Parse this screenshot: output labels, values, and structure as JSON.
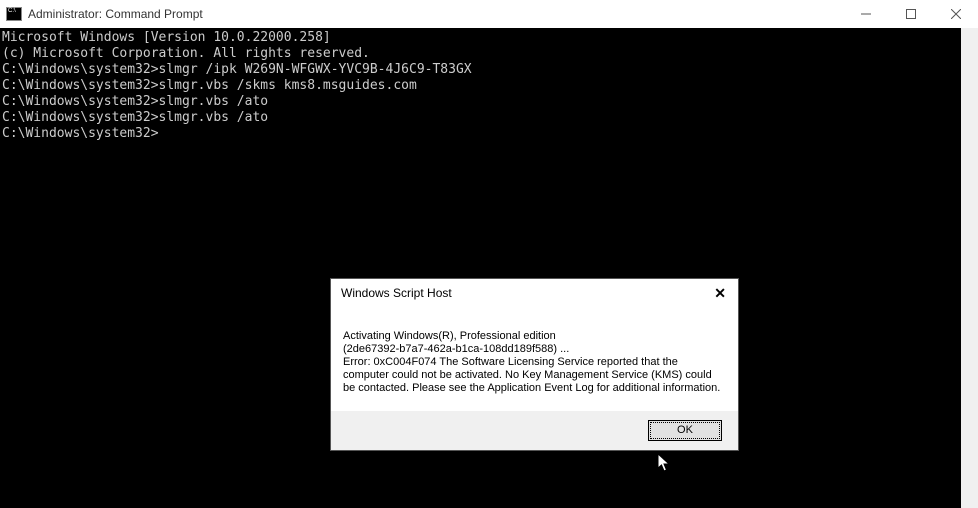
{
  "window": {
    "title": "Administrator: Command Prompt"
  },
  "terminal": {
    "line1": "Microsoft Windows [Version 10.0.22000.258]",
    "line2": "(c) Microsoft Corporation. All rights reserved.",
    "blank1": "",
    "line3": "C:\\Windows\\system32>slmgr /ipk W269N-WFGWX-YVC9B-4J6C9-T83GX",
    "blank2": "",
    "line4": "C:\\Windows\\system32>slmgr.vbs /skms kms8.msguides.com",
    "blank3": "",
    "line5": "C:\\Windows\\system32>slmgr.vbs /ato",
    "blank4": "",
    "line6": "C:\\Windows\\system32>slmgr.vbs /ato",
    "blank5": "",
    "line7": "C:\\Windows\\system32>"
  },
  "dialog": {
    "title": "Windows Script Host",
    "body_line1": "Activating Windows(R), Professional edition",
    "body_line2": "(2de67392-b7a7-462a-b1ca-108dd189f588) ...",
    "body_line3": "Error: 0xC004F074 The Software Licensing Service reported that the computer could not be activated. No Key Management Service (KMS) could be contacted. Please see the Application Event Log for additional information.",
    "ok": "OK"
  }
}
